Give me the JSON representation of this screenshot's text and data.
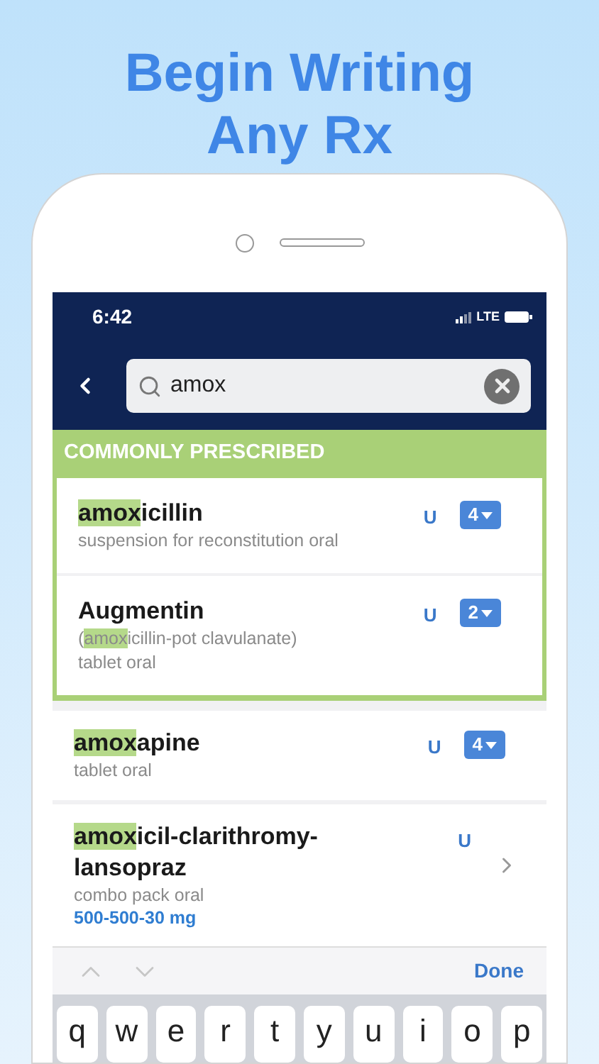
{
  "headline": [
    "Begin Writing",
    "Any Rx"
  ],
  "status_bar": {
    "time": "6:42",
    "network": "LTE"
  },
  "search": {
    "value": "amox"
  },
  "section": {
    "title": "COMMONLY PRESCRIBED"
  },
  "common": [
    {
      "name": [
        {
          "text": "amox",
          "highlight": true
        },
        {
          "text": "icillin",
          "highlight": false
        }
      ],
      "details": [
        [
          {
            "text": "suspension for reconstitution oral",
            "highlight": false
          }
        ]
      ],
      "flag": "U",
      "count": "4",
      "kind": "dropdown"
    },
    {
      "name": [
        {
          "text": "Augmentin",
          "highlight": false
        }
      ],
      "details": [
        [
          {
            "text": "(",
            "highlight": false
          },
          {
            "text": "amox",
            "highlight": true
          },
          {
            "text": "icillin-pot clavulanate)",
            "highlight": false
          }
        ],
        [
          {
            "text": "tablet oral",
            "highlight": false
          }
        ]
      ],
      "flag": "U",
      "count": "2",
      "kind": "dropdown"
    }
  ],
  "results": [
    {
      "name": [
        {
          "text": "amox",
          "highlight": true
        },
        {
          "text": "apine",
          "highlight": false
        }
      ],
      "details": [
        [
          {
            "text": "tablet oral",
            "highlight": false
          }
        ]
      ],
      "flag": "U",
      "count": "4",
      "kind": "dropdown"
    },
    {
      "name": [
        {
          "text": "amox",
          "highlight": true
        },
        {
          "text": "icil-clarithromy-lansopraz",
          "highlight": false
        }
      ],
      "details": [
        [
          {
            "text": "combo pack oral",
            "highlight": false
          }
        ]
      ],
      "dose": "500-500-30  mg",
      "flag": "U",
      "kind": "chevron"
    }
  ],
  "keyboard_bar": {
    "done": "Done"
  },
  "keys": [
    "q",
    "w",
    "e",
    "r",
    "t",
    "y",
    "u",
    "i",
    "o",
    "p"
  ]
}
